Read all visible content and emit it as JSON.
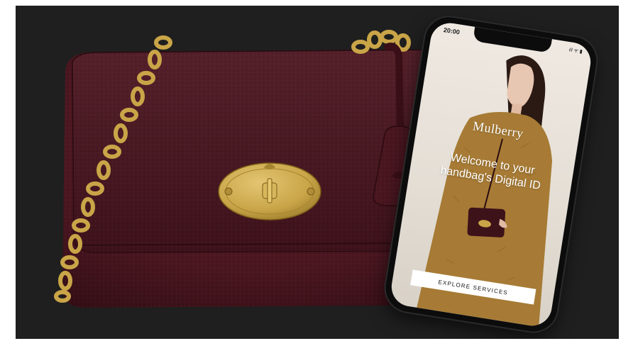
{
  "phone": {
    "status_time": "20:00",
    "status_icons": "ıll ᯤ ▮",
    "brand": "Mulberry",
    "welcome_line1": "Welcome to your",
    "welcome_line2": "handbag's Digital ID",
    "cta_label": "EXPLORE SERVICES"
  },
  "colors": {
    "background": "#1f1f1f",
    "bag_leather": "#4a1620",
    "bag_hardware": "#c9a548",
    "coat": "#b78a3c",
    "screen_bg": "#efe9e2",
    "cta_bg": "#ffffff"
  },
  "icons": {
    "left_mark": "outside-mark-icon"
  }
}
